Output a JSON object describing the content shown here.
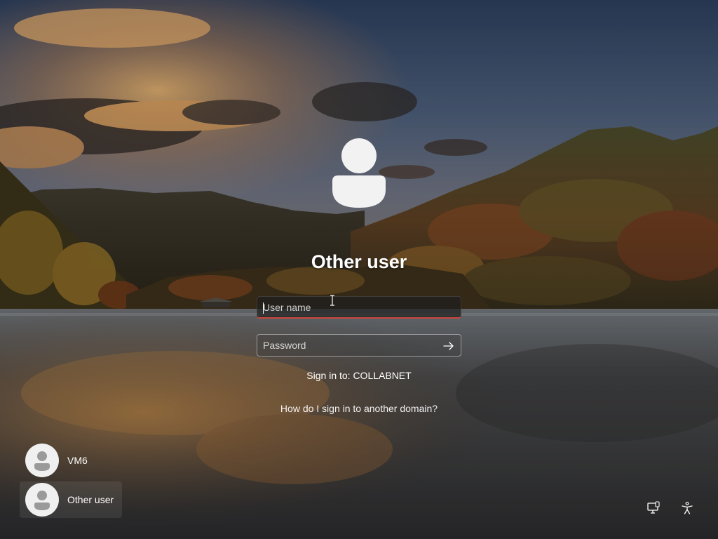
{
  "screen": {
    "title": "Other user"
  },
  "signin": {
    "username_placeholder": "User name",
    "password_placeholder": "Password",
    "sign_in_to": "Sign in to: COLLABNET",
    "help_link": "How do I sign in to another domain?"
  },
  "user_list": [
    {
      "label": "VM6",
      "selected": false
    },
    {
      "label": "Other user",
      "selected": true
    }
  ],
  "icons": {
    "large_avatar": "user-avatar-icon",
    "submit": "arrow-right-icon",
    "network": "network-icon",
    "accessibility": "accessibility-icon"
  },
  "colors": {
    "focus_underline": "#c8463c",
    "text": "#ffffff"
  }
}
